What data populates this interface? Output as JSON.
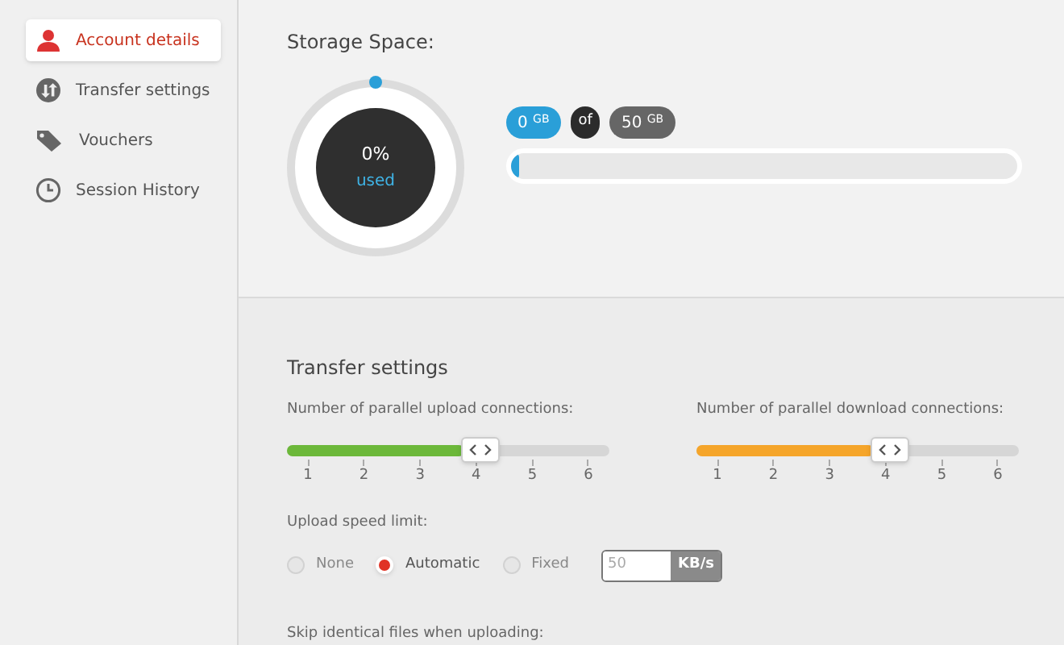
{
  "sidebar": {
    "items": [
      {
        "label": "Account details",
        "kind": "person",
        "selected": true
      },
      {
        "label": "Transfer settings",
        "kind": "transfer",
        "selected": false
      },
      {
        "label": "Vouchers",
        "kind": "tag",
        "selected": false
      },
      {
        "label": "Session History",
        "kind": "clock",
        "selected": false
      }
    ]
  },
  "storage": {
    "title": "Storage Space:",
    "percent": "0%",
    "used_label": "used",
    "used": "0",
    "used_unit": "GB",
    "of": "of",
    "total": "50",
    "total_unit": "GB"
  },
  "transfer": {
    "title": "Transfer settings",
    "sliders": [
      {
        "label": "Number of parallel upload connections:",
        "color": "#6cb83a",
        "level": 0.55,
        "ticks": [
          "1",
          "2",
          "3",
          "4",
          "5",
          "6"
        ]
      },
      {
        "label": "Number of parallel download connections:",
        "color": "#f5a52a",
        "level": 0.55,
        "ticks": [
          "1",
          "2",
          "3",
          "4",
          "5",
          "6"
        ]
      }
    ],
    "speed_limit": {
      "label": "Upload speed limit:",
      "options": [
        {
          "label": "None",
          "selected": false
        },
        {
          "label": "Automatic",
          "selected": true
        },
        {
          "label": "Fixed",
          "selected": false
        }
      ],
      "value": "50",
      "unit": "KB/s"
    },
    "skip_label": "Skip identical files when uploading:"
  }
}
